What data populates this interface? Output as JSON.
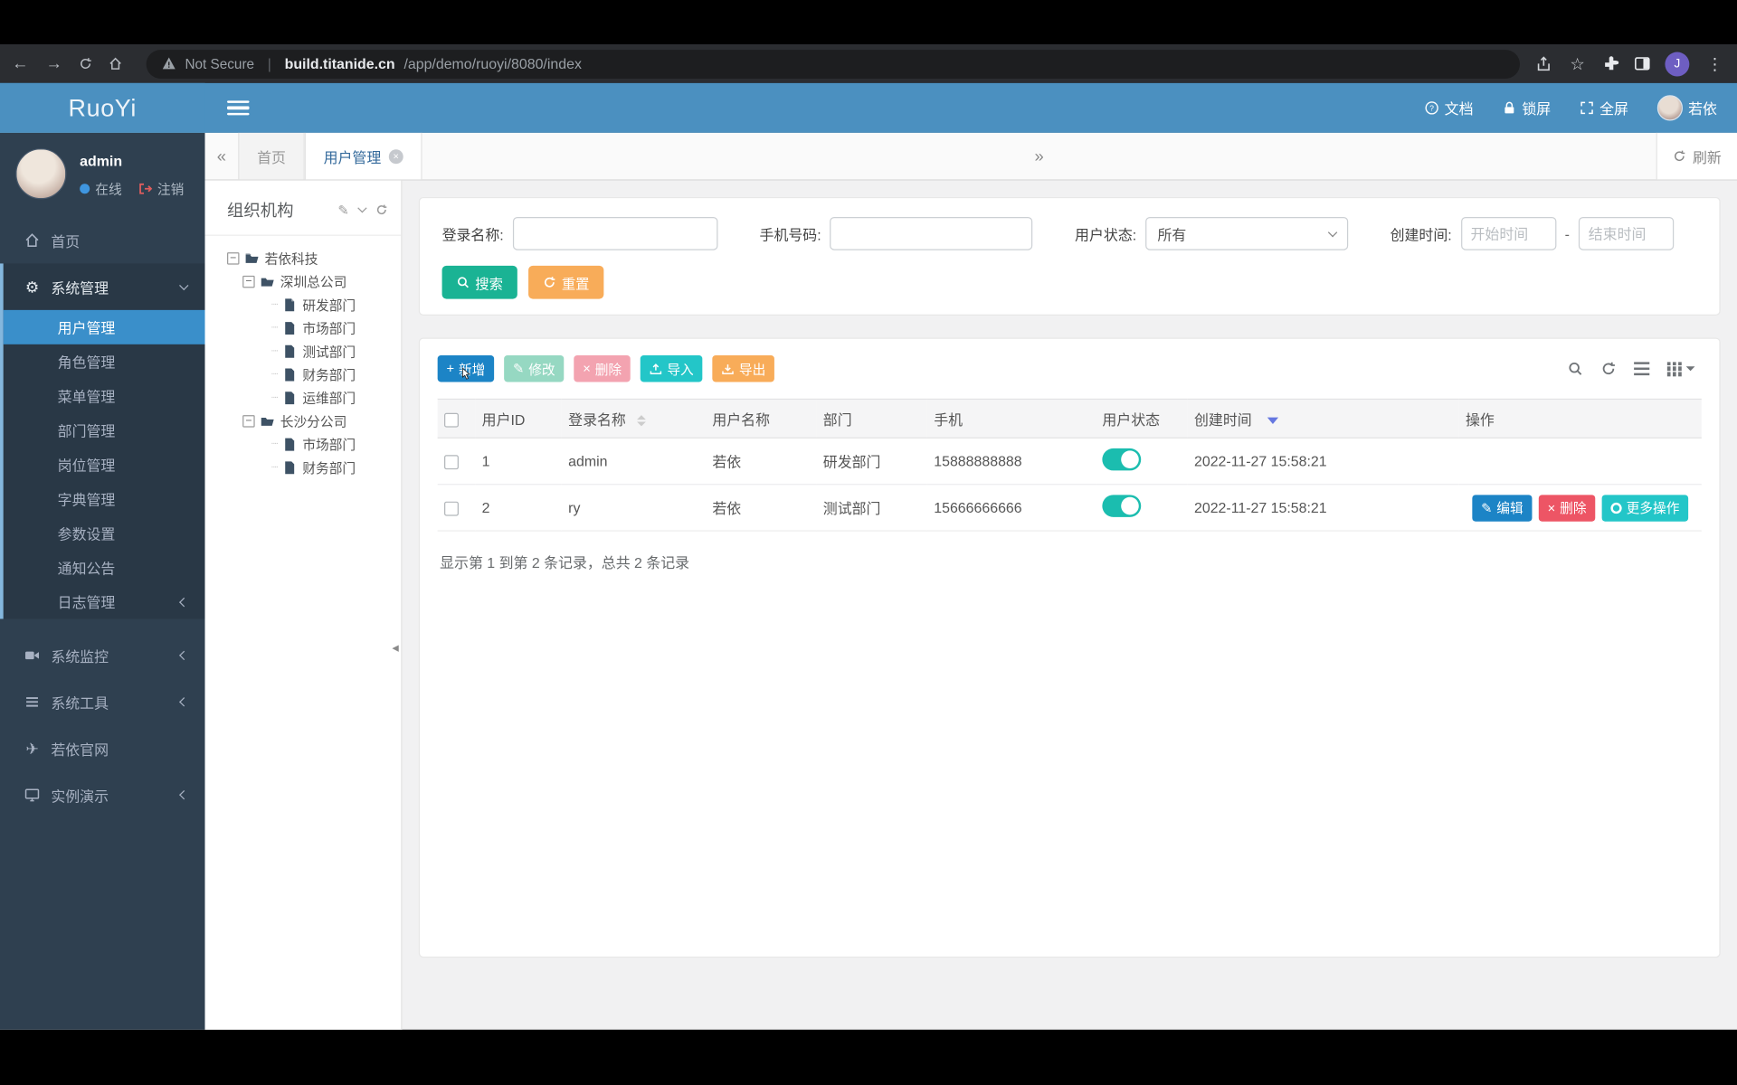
{
  "browser": {
    "security_label": "Not Secure",
    "url_domain": "build.titanide.cn",
    "url_path": "/app/demo/ruoyi/8080/index",
    "profile_initial": "J"
  },
  "navbar": {
    "logo": "RuoYi",
    "doc": "文档",
    "lock": "锁屏",
    "fullscreen": "全屏",
    "user": "若依"
  },
  "sidebar": {
    "user_name": "admin",
    "status_online": "在线",
    "logout": "注销",
    "home": "首页",
    "system_manage": "系统管理",
    "submenu": {
      "user": "用户管理",
      "role": "角色管理",
      "menu": "菜单管理",
      "dept": "部门管理",
      "post": "岗位管理",
      "dict": "字典管理",
      "config": "参数设置",
      "notice": "通知公告",
      "log": "日志管理"
    },
    "system_monitor": "系统监控",
    "system_tools": "系统工具",
    "official_site": "若依官网",
    "demo": "实例演示"
  },
  "tabs": {
    "home": "首页",
    "active": "用户管理",
    "refresh": "刷新"
  },
  "tree": {
    "title": "组织机构",
    "nodes": [
      {
        "label": "若依科技",
        "depth": 0,
        "type": "folder"
      },
      {
        "label": "深圳总公司",
        "depth": 1,
        "type": "folder"
      },
      {
        "label": "研发部门",
        "depth": 2,
        "type": "file"
      },
      {
        "label": "市场部门",
        "depth": 2,
        "type": "file"
      },
      {
        "label": "测试部门",
        "depth": 2,
        "type": "file"
      },
      {
        "label": "财务部门",
        "depth": 2,
        "type": "file"
      },
      {
        "label": "运维部门",
        "depth": 2,
        "type": "file"
      },
      {
        "label": "长沙分公司",
        "depth": 1,
        "type": "folder"
      },
      {
        "label": "市场部门",
        "depth": 2,
        "type": "file"
      },
      {
        "label": "财务部门",
        "depth": 2,
        "type": "file"
      }
    ]
  },
  "search": {
    "login_label": "登录名称:",
    "phone_label": "手机号码:",
    "status_label": "用户状态:",
    "status_value": "所有",
    "created_label": "创建时间:",
    "start_placeholder": "开始时间",
    "date_separator": "-",
    "end_placeholder": "结束时间",
    "search_btn": "搜索",
    "reset_btn": "重置"
  },
  "toolbar": {
    "add": "新增",
    "edit": "修改",
    "delete": "删除",
    "import": "导入",
    "export": "导出"
  },
  "table": {
    "columns": {
      "id": "用户ID",
      "login": "登录名称",
      "name": "用户名称",
      "dept": "部门",
      "phone": "手机",
      "status": "用户状态",
      "created": "创建时间",
      "ops": "操作"
    },
    "rows": [
      {
        "id": "1",
        "login": "admin",
        "name": "若依",
        "dept": "研发部门",
        "phone": "15888888888",
        "created": "2022-11-27 15:58:21"
      },
      {
        "id": "2",
        "login": "ry",
        "name": "若依",
        "dept": "测试部门",
        "phone": "15666666666",
        "created": "2022-11-27 15:58:21"
      }
    ],
    "row_actions": {
      "edit": "编辑",
      "delete": "删除",
      "more": "更多操作"
    },
    "summary": "显示第 1 到第 2 条记录，总共 2 条记录"
  },
  "icons": {
    "back": "←",
    "forward": "→",
    "star": "☆",
    "dots": "⋮",
    "roll_left": "«",
    "roll_right": "»",
    "close": "×",
    "pencil": "✎",
    "gear": "⚙",
    "plane": "✈",
    "plus": "+",
    "x": "×",
    "minus": "−",
    "handle_left": "◂"
  },
  "colors": {
    "navbar_blue": "#4b90c0",
    "sidebar_dark": "#2f4050",
    "active_item": "#3a8fca",
    "primary_blue": "#1c84c6",
    "success_green": "#1ab394",
    "warning_orange": "#f8ac59",
    "info_cyan": "#23c6c8",
    "danger_red": "#ed5565",
    "toggle_teal": "#1bbdaf"
  }
}
